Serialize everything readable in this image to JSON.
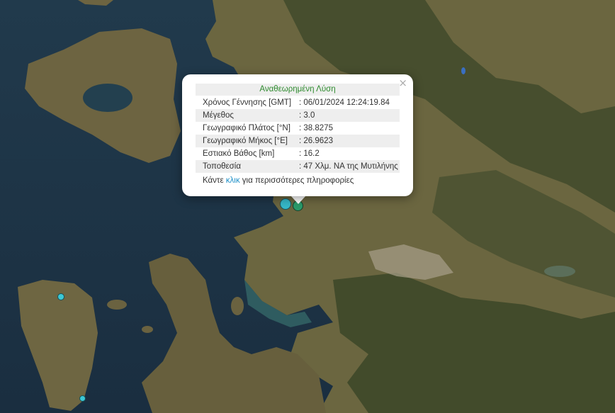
{
  "popup": {
    "title": "Αναθεωρημένη Λύση",
    "close_icon": "×",
    "rows": [
      {
        "label": "Χρόνος Γέννησης [GMT]",
        "value": ": 06/01/2024 12:24:19.84"
      },
      {
        "label": "Μέγεθος",
        "value": ": 3.0"
      },
      {
        "label": "Γεωγραφικό Πλάτος [°N]",
        "value": ": 38.8275"
      },
      {
        "label": "Γεωγραφικό Μήκος [°E]",
        "value": ": 26.9623"
      },
      {
        "label": "Εστιακό Βάθος [km]",
        "value": ": 16.2"
      },
      {
        "label": "Τοποθεσία",
        "value": ": 47 Χλμ. ΝΑ της Μυτιλήνης"
      }
    ],
    "more_prefix": "Κάντε ",
    "more_link": "κλικ",
    "more_suffix": " για περισσότερες πληροφορίες"
  },
  "markers": {
    "selected_color": "#2a9a6a",
    "other_color": "#3cc8d6"
  },
  "colors": {
    "sea": "#1e3346",
    "land": "#6b6a45",
    "mountain": "#3f4a2a",
    "urban": "#a79f88"
  }
}
